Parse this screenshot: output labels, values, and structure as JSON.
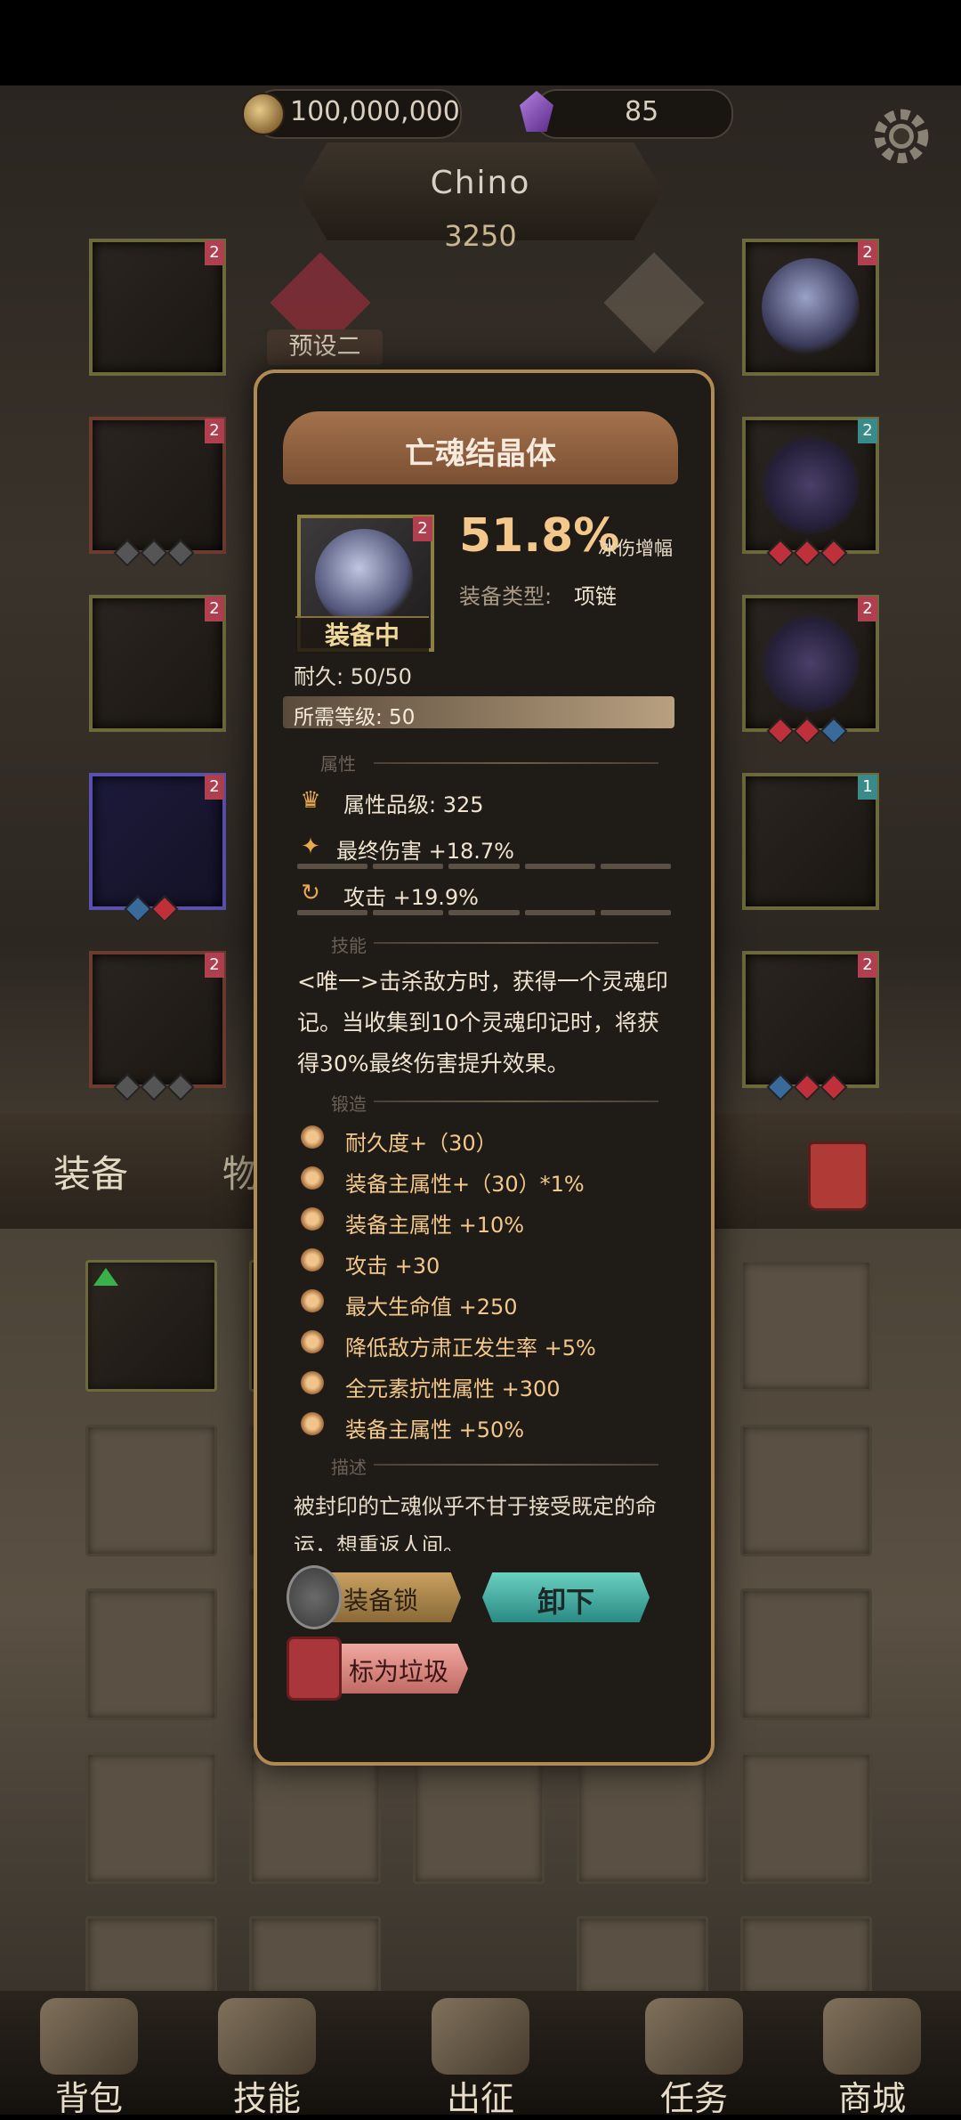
{
  "resources": {
    "gold": "100,000,000",
    "gems": "85"
  },
  "character": {
    "name": "Chino",
    "power": "3250"
  },
  "preset": {
    "label": "预设二"
  },
  "equipment_slots": [
    {
      "side": "left",
      "badge": "2",
      "style": "gold"
    },
    {
      "side": "left",
      "badge": "2",
      "style": "red"
    },
    {
      "side": "left",
      "badge": "2",
      "style": "gold"
    },
    {
      "side": "left",
      "badge": "2",
      "style": "blue"
    },
    {
      "side": "left",
      "badge": "2",
      "style": "red"
    },
    {
      "side": "right",
      "badge": "2",
      "style": "gold"
    },
    {
      "side": "right",
      "badge": "2",
      "style": "gold"
    },
    {
      "side": "right",
      "badge": "2",
      "style": "gold"
    },
    {
      "side": "right",
      "badge": "1",
      "style": "gold"
    },
    {
      "side": "right",
      "badge": "2",
      "style": "gold"
    }
  ],
  "tabs": {
    "equip": "装备",
    "items": "物品"
  },
  "popup": {
    "title": "亡魂结晶体",
    "item_badge": "2",
    "equipped": "装备中",
    "main_stat_value": "51.8%",
    "main_stat_label": "冰伤增幅",
    "type_label": "装备类型:",
    "type_value": "项链",
    "durability": "耐久: 50/50",
    "required_level": "所需等级: 50",
    "sections": {
      "attributes": "属性",
      "skills": "技能",
      "forging": "锻造",
      "description": "描述"
    },
    "attribute_grade": "属性品级: 325",
    "stats": [
      "最终伤害 +18.7%",
      "攻击 +19.9%"
    ],
    "skill_text": "<唯一>击杀敌方时，获得一个灵魂印记。当收集到10个灵魂印记时，将获得30%最终伤害提升效果。",
    "forging": [
      "耐久度+（30）",
      "装备主属性+（30）*1%",
      "装备主属性 +10%",
      "攻击 +30",
      "最大生命值 +250",
      "降低敌方肃正发生率 +5%",
      "全元素抗性属性 +300",
      "装备主属性 +50%"
    ],
    "description": "被封印的亡魂似乎不甘于接受既定的命运，想重返人间。",
    "buttons": {
      "lock": "装备锁",
      "unequip": "卸下",
      "junk": "标为垃圾"
    }
  },
  "nav": [
    {
      "label": "背包",
      "icon": "backpack-icon"
    },
    {
      "label": "技能",
      "icon": "skill-book-icon"
    },
    {
      "label": "出征",
      "icon": "sword-icon"
    },
    {
      "label": "任务",
      "icon": "scroll-icon"
    },
    {
      "label": "商城",
      "icon": "shop-crown-icon"
    }
  ],
  "colors": {
    "accent": "#f3c88a",
    "frame": "#b08a50",
    "unequip": "#3ab0a4",
    "junk": "#e08a84"
  }
}
